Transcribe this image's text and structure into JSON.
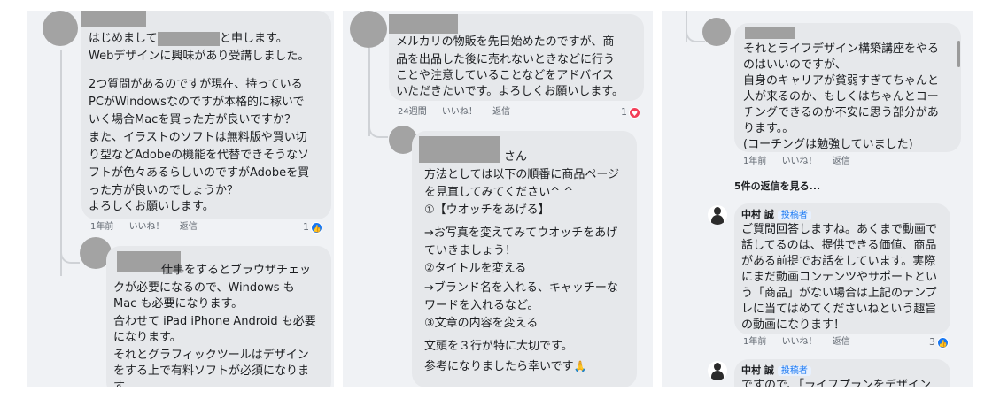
{
  "panel1": {
    "comment1": {
      "lines": [
        "はじめまして",
        "と申します。",
        "Webデザインに興味があり受講しました。",
        "2つ質問があるのですが現在、持っている",
        "PCがWindowsなのですが本格的に稼いで",
        "いく場合Macを買った方が良いですか？",
        "また、イラストのソフトは無料版や買い切",
        "り型などAdobeの機能を代替できそうなソ",
        "フトが色々あるらしいのですがAdobeを買",
        "った方が良いのでしょうか？",
        "よろしくお願いします。"
      ],
      "time": "1年前",
      "like": "いいね！",
      "reply": "返信",
      "reactions": "1"
    },
    "comment2": {
      "lines": [
        "仕事をするとブラウザチェッ",
        "クが必要になるので、Windows も",
        "Mac も必要になります。",
        "合わせて iPad iPhone Android も必要",
        "になります。",
        "それとグラフィックツールはデザイン",
        "をする上で有料ソフトが必須になりま",
        "す。"
      ]
    }
  },
  "panel2": {
    "comment1": {
      "lines": [
        "メルカリの物販を先日始めたのですが、商",
        "品を出品した後に売れないときなどに行う",
        "ことや注意していることなどをアドバイス",
        "いただきたいです。よろしくお願いします。"
      ],
      "time": "24週間",
      "like": "いいね！",
      "reply": "返信",
      "reactions": "1"
    },
    "comment2": {
      "lines": [
        "さん",
        "方法としては以下の順番に商品ページ",
        "を見直してみてください^ ^",
        "①【ウオッチをあげる】",
        "→お写真を変えてみてウオッチをあげ",
        "ていきましょう！",
        "②タイトルを変える",
        "→ブランド名を入れる、キャッチーな",
        "ワードを入れるなど。",
        "③文章の内容を変える",
        "文頭を３行が特に大切です。",
        "参考になりましたら幸いです"
      ],
      "emoji": "🙏"
    }
  },
  "panel3": {
    "comment1": {
      "lines": [
        "それとライフデザイン構築講座をやる",
        "のはいいのですが、",
        "自身のキャリアが貧弱すぎてちゃんと",
        "人が来るのか、もしくはちゃんとコー",
        "チングできるのか不安に思う部分があ",
        "ります。。",
        "(コーチングは勉強していました)"
      ],
      "time": "1年前",
      "like": "いいね！",
      "reply": "返信"
    },
    "see_replies": "5件の返信を見る...",
    "reply1": {
      "author": "中村 誠",
      "badge": "投稿者",
      "lines": [
        "ご質問回答しますね。あくまで動画で",
        "話してるのは、提供できる価値、商品",
        "がある前提でお話をしています。実際",
        "にまだ動画コンテンツやサポートとい",
        "う「商品」がない場合は上記のテンプ",
        "レに当てはめてくださいねという趣旨",
        "の動画になります！"
      ],
      "time": "1年前",
      "like": "いいね！",
      "reply": "返信",
      "reactions": "3"
    },
    "reply2": {
      "author": "中村 誠",
      "badge": "投稿者",
      "partial_line": "ですので、「ライフプランをデザイン"
    }
  },
  "icons": {
    "like": "thumbs-up-icon",
    "love": "heart-icon"
  },
  "colors": {
    "panel_bg": "#f0f2f5",
    "bubble_bg": "#e6e8eb",
    "like_blue": "#1877f2",
    "love_red": "#f33e58"
  }
}
